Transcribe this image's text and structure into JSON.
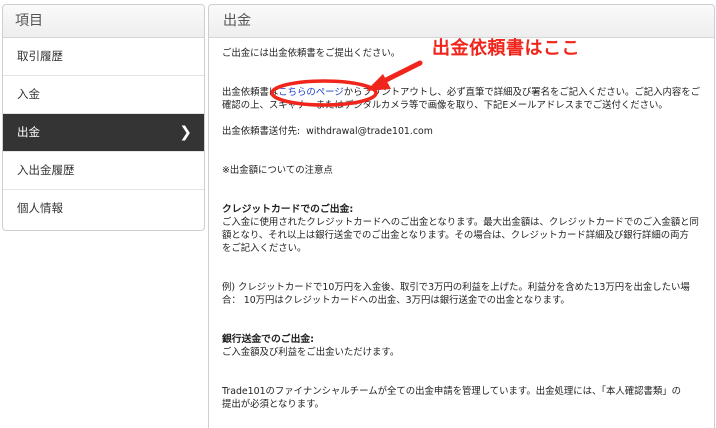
{
  "sidebar": {
    "header": "項目",
    "items": [
      {
        "label": "取引履歴",
        "active": false
      },
      {
        "label": "入金",
        "active": false
      },
      {
        "label": "出金",
        "active": true
      },
      {
        "label": "入出金履歴",
        "active": false
      },
      {
        "label": "個人情報",
        "active": false
      }
    ],
    "active_chevron": "❯"
  },
  "panel": {
    "title": "出金",
    "intro": "ご出金には出金依頼書をご提出ください。",
    "para2_line1_a": "出金依頼書は",
    "para2_link": "こちらのページ",
    "para2_line1_b": "からプリントアウトし、必ず直筆で詳細及び署名をご記入ください。ご記入内容をご",
    "para2_line2": "確認の上、スキャナーまたはデジタルカメラ等で画像を取り、下記Eメールアドレスまでご送付ください。",
    "email_label": "出金依頼書送付先:",
    "email": "withdrawal@trade101.com",
    "notice": "※出金額についての注意点",
    "credit_heading": "クレジットカードでのご出金:",
    "credit_line1": "ご入金に使用されたクレジットカードへのご出金となります。最大出金額は、クレジットカードでのご入金額と同",
    "credit_line2": "額となり、それ以上は銀行送金でのご出金となります。その場合は、クレジットカード詳細及び銀行詳細の両方",
    "credit_line3": "をご記入ください。",
    "example_line1": "例) クレジットカードで10万円を入金後、取引で3万円の利益を上げた。利益分を含めた13万円を出金したい場",
    "example_line2": "合：  10万円はクレジットカードへの出金、3万円は銀行送金での出金となります。",
    "bank_heading": "銀行送金でのご出金:",
    "bank_line1": "ご入金額及び利益をご出金いただけます。",
    "final_line1": "Trade101のファイナンシャルチームが全ての出金申請を管理しています。出金処理には、「本人確認書類」の",
    "final_line2": "提出が必須となります。"
  },
  "annotation": {
    "text": "出金依頼書はここ",
    "color": "#f0261c"
  },
  "colors": {
    "active_bg": "#343434",
    "link": "#1a3fc7",
    "annotation": "#f0261c"
  }
}
